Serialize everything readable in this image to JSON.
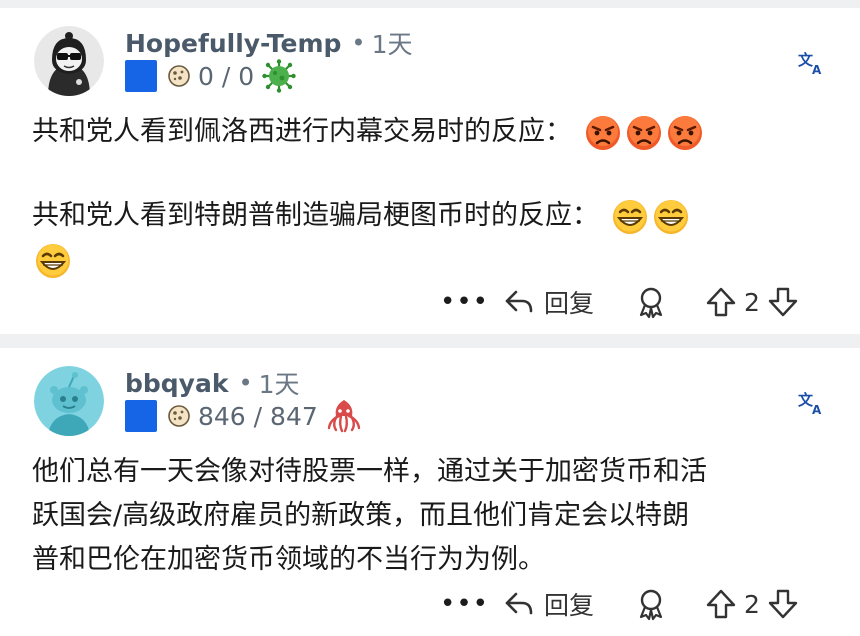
{
  "comments": [
    {
      "username": "Hopefully-Temp",
      "separator": "•",
      "time": "1天",
      "karma": "0 / 0",
      "body_line1": "共和党人看到佩洛西进行内幕交易时的反应：",
      "body_line2": "共和党人看到特朗普制造骗局梗图币时的反应：",
      "emojis_line1": [
        "angry-face",
        "angry-face",
        "angry-face"
      ],
      "emojis_line2": [
        "grinning-face",
        "grinning-face",
        "grinning-face"
      ],
      "more_label": "•••",
      "reply_label": "回复",
      "votes": "2"
    },
    {
      "username": "bbqyak",
      "separator": "•",
      "time": "1天",
      "karma": "846 / 847",
      "body_line1": "他们总有一天会像对待股票一样，通过关于加密货币和活",
      "body_line2": "跃国会/高级政府雇员的新政策，而且他们肯定会以特朗",
      "body_line3": "普和巴伦在加密货币领域的不当行为为例。",
      "more_label": "•••",
      "reply_label": "回复",
      "votes": "2"
    }
  ],
  "colors": {
    "accent_blue": "#1565e6",
    "username": "#4a5a6a",
    "meta": "#6b7785"
  },
  "icons": [
    "avatar-hooded",
    "avatar-snoo",
    "cookie-icon",
    "virus-icon",
    "squid-icon",
    "translate-icon",
    "reply-icon",
    "award-icon",
    "upvote-icon",
    "downvote-icon"
  ]
}
